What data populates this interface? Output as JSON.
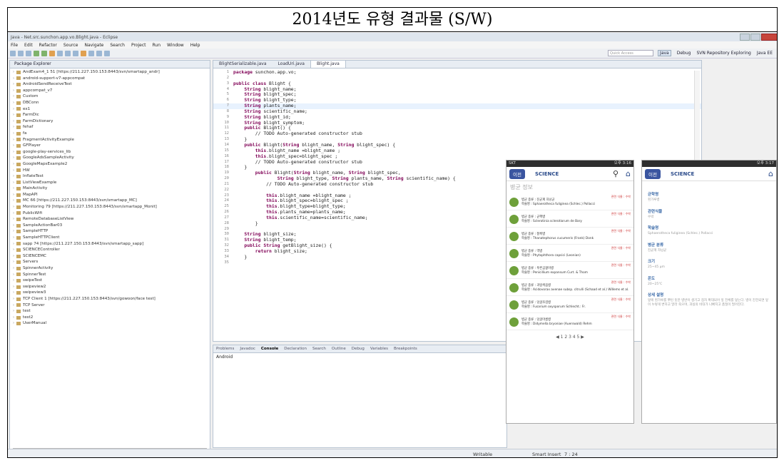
{
  "doc_title": "2014년도 유형 결과물 (S/W)",
  "window_title": "Java - Net.src.sunchon.app.vo.Blight.java - Eclipse",
  "menu": [
    "File",
    "Edit",
    "Refactor",
    "Source",
    "Navigate",
    "Search",
    "Project",
    "Run",
    "Window",
    "Help"
  ],
  "toolbar": {
    "quick_access": "Quick Access",
    "perspectives": [
      "Java",
      "Debug",
      "SVN Repository Exploring",
      "Java EE"
    ]
  },
  "package_explorer": {
    "title": "Package Explorer",
    "items": [
      "AndExam4_1 51 [https://211.227.150.153:8443/svn/smartapp_andr]",
      "android-support-v7-appcompat",
      "AndroidSendReceiveTest",
      "appcompat_v7",
      "Custom",
      "DBConn",
      "ex1",
      "FarmDic",
      "FarmDictionary",
      "fehaf",
      "fa",
      "FragmentActivityExample",
      "GFPlayer",
      "google-play-services_lib",
      "GoogleAdsSampleActivity",
      "GoogleMapsExample2",
      "HW",
      "InflateTest",
      "ListViewExample",
      "MainActivity",
      "MapAPI",
      "MC 66 [https://211.227.150.153:8443/svn/smartapp_MC]",
      "Monitoring 79 [https://211.227.150.153:8443/svn/smartapp_Monit]",
      "PublicWifi",
      "RemoteDatabaseListView",
      "SampleActionBar03",
      "SampleHTTP",
      "SampleHTTPClient",
      "sapp 74 [https://211.227.150.153:8443/svn/smartapp_sapp]",
      "SCIENCEController",
      "SCIENCEMC",
      "Servers",
      "SpinnerActivity",
      "SpinnerTest",
      "swipeTest",
      "swipeview2",
      "swipeview3",
      "TCP Client 1 [https://211.227.150.153:8443/svn/gowoon/face test]",
      "TCP Server",
      "test",
      "test2",
      "UserManual"
    ]
  },
  "editor": {
    "tabs": [
      "BlightSerializable.java",
      "LoadUri.java",
      "Blight.java"
    ],
    "active_tab": "Blight.java",
    "code": [
      {
        "n": "1",
        "t": "package sunchon.app.vo;"
      },
      {
        "n": "2",
        "t": ""
      },
      {
        "n": "3",
        "t": "public class Blight {"
      },
      {
        "n": "4",
        "t": "    String blight_name;"
      },
      {
        "n": "5",
        "t": "    String blight_spec;"
      },
      {
        "n": "6",
        "t": "    String blight_type;"
      },
      {
        "n": "7",
        "t": "    String plants_name;"
      },
      {
        "n": "8",
        "t": "    String scientific_name;"
      },
      {
        "n": "9",
        "t": "    String blight_id;"
      },
      {
        "n": "10",
        "t": "    String blight_symptom;"
      },
      {
        "n": "11",
        "t": "    public Blight() {"
      },
      {
        "n": "12",
        "t": "        // TODO Auto-generated constructor stub"
      },
      {
        "n": "13",
        "t": "    }"
      },
      {
        "n": "14",
        "t": "    public Blight(String blight_name, String blight_spec) {"
      },
      {
        "n": "15",
        "t": "        this.blight_name =blight_name ;"
      },
      {
        "n": "16",
        "t": "        this.blight_spec=blight_spec ;"
      },
      {
        "n": "17",
        "t": "        // TODO Auto-generated constructor stub"
      },
      {
        "n": "18",
        "t": "    }"
      },
      {
        "n": "19",
        "t": "        public Blight(String blight_name, String blight_spec,"
      },
      {
        "n": "20",
        "t": "                String blight_type, String plants_name, String scientific_name) {"
      },
      {
        "n": "21",
        "t": "            // TODO Auto-generated constructor stub"
      },
      {
        "n": "22",
        "t": ""
      },
      {
        "n": "23",
        "t": "            this.blight_name =blight_name ;"
      },
      {
        "n": "24",
        "t": "            this.blight_spec=blight_spec ;"
      },
      {
        "n": "25",
        "t": "            this.blight_type=blight_type;"
      },
      {
        "n": "26",
        "t": "            this.plants_name=plants_name;"
      },
      {
        "n": "27",
        "t": "            this.scientific_name=scientific_name;"
      },
      {
        "n": "28",
        "t": "        }"
      },
      {
        "n": "29",
        "t": ""
      },
      {
        "n": "30",
        "t": "    String blight_size;"
      },
      {
        "n": "31",
        "t": "    String blight_temp;"
      },
      {
        "n": "32",
        "t": "    public String getBlight_size() {"
      },
      {
        "n": "33",
        "t": "        return blight_size;"
      },
      {
        "n": "34",
        "t": "    }"
      },
      {
        "n": "35",
        "t": ""
      }
    ]
  },
  "console": {
    "tabs": [
      "Problems",
      "Javadoc",
      "Console",
      "Declaration",
      "Search",
      "Outline",
      "Debug",
      "Variables",
      "Breakpoints"
    ],
    "active": "Console",
    "content": "Android"
  },
  "status": {
    "writable": "Writable",
    "insert": "Smart Insert",
    "position": "7 : 24"
  },
  "phone1": {
    "status_left": "SKT",
    "time": "오후 3:16",
    "back": "이전",
    "logo": "SCIENCE",
    "title": "병균 정보",
    "items": [
      {
        "line1": "병균 종류 : 진균계 자낭균",
        "line2": "학술명 : Sphaerotheca fuliginea (Schlec.) Pollacci",
        "meta": "관련 식물 : 수박"
      },
      {
        "line1": "병균 종류 : 균핵병",
        "line2": "학술명 : Sclerotinia sclerotiorum de Bary",
        "meta": "관련 식물 : 수박"
      },
      {
        "line1": "병균 종류 : 잘록병",
        "line2": "학술명 : Thanatephorus cucumeris (Frank) Donk",
        "meta": "관련 식물 : 수박"
      },
      {
        "line1": "병균 종류 : 역병",
        "line2": "학술명 : Phytophthora capsici (Leonian)",
        "meta": "관련 식물 : 수박"
      },
      {
        "line1": "병균 종류 : 푸른곰팡이병",
        "line2": "학술명 : Penicillium expansum Curt. & Thom",
        "meta": "관련 식물 : 수박"
      },
      {
        "line1": "병균 종류 : 과일썩음병",
        "line2": "학술명 : Acidovorax avenae subsp. citrulli (Schaad et al.) Willems et al.",
        "meta": "관련 식물 : 수박"
      },
      {
        "line1": "병균 종류 : 덩굴쪼김병",
        "line2": "학술명 : Fusarium oxysporum Schlecht.: Fr.",
        "meta": "관련 식물 : 수박"
      },
      {
        "line1": "병균 종류 : 덩굴마름병",
        "line2": "학술명 : Didymella bryoniae (Auerswald) Rehm",
        "meta": "관련 식물 : 수박"
      }
    ],
    "pager": "◀ 1 2 3 4 5 ▶"
  },
  "phone2": {
    "time": "오후 3:17",
    "back": "이전",
    "logo": "SCIENCE",
    "fields": [
      {
        "label": "균학명",
        "value": "흰가루병"
      },
      {
        "label": "관련식물",
        "value": "수박"
      },
      {
        "label": "학술명",
        "value": "Sphaerotheca fuliginea (Schlec.) Pollacci"
      },
      {
        "label": "병균 분류",
        "value": "진균계 자낭균"
      },
      {
        "label": "크기",
        "value": "25~45 μm"
      },
      {
        "label": "온도",
        "value": "20~25℃"
      },
      {
        "label": "상세 설명",
        "value": "잎에 흰가루를 뿌린 듯한 병반이 생기고 점차 확대되어 잎 전체를 덮는다. 병이 진전되면 잎이 누렇게 변하고 말라 죽으며, 과실의 비대가 나빠지고 품질이 떨어진다."
      }
    ]
  }
}
